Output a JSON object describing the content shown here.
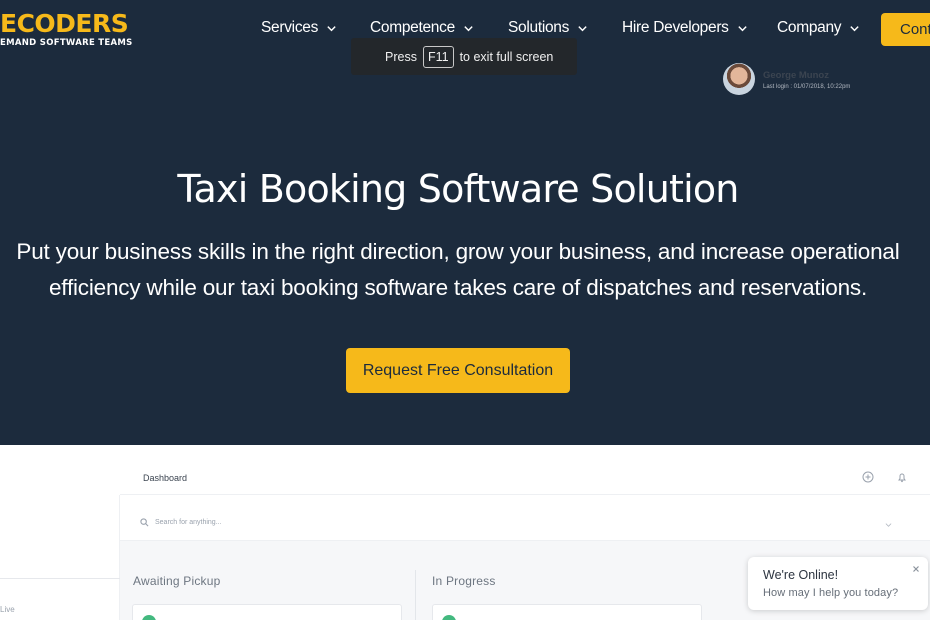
{
  "logo": {
    "name": "ECODERS",
    "tagline": "EMAND SOFTWARE TEAMS"
  },
  "nav": {
    "items": [
      {
        "label": "Services"
      },
      {
        "label": "Competence"
      },
      {
        "label": "Solutions"
      },
      {
        "label": "Hire Developers"
      },
      {
        "label": "Company"
      }
    ],
    "contact_label": "Cont"
  },
  "toast": {
    "prefix": "Press",
    "key": "F11",
    "suffix": "to exit full screen"
  },
  "hero": {
    "title": "Taxi Booking Software Solution",
    "subtitle_line1": "Put your business skills in the right direction, grow your business, and increase operational",
    "subtitle_line2": "efficiency while our taxi booking software takes care of dispatches and reservations.",
    "cta_label": "Request Free Consultation"
  },
  "preview": {
    "dashboard_label": "Dashboard",
    "search_placeholder": "Search for anything...",
    "user_name": "George Munoz",
    "last_login": "Last login : 01/07/2018, 10:22pm",
    "sidebar_live": "Live",
    "columns": [
      {
        "title": "Awaiting Pickup"
      },
      {
        "title": "In Progress"
      }
    ]
  },
  "chat": {
    "title": "We're Online!",
    "subtitle": "How may I help you today?"
  },
  "colors": {
    "navy": "#1c2b3d",
    "accent": "#f6b91a",
    "white": "#ffffff"
  }
}
